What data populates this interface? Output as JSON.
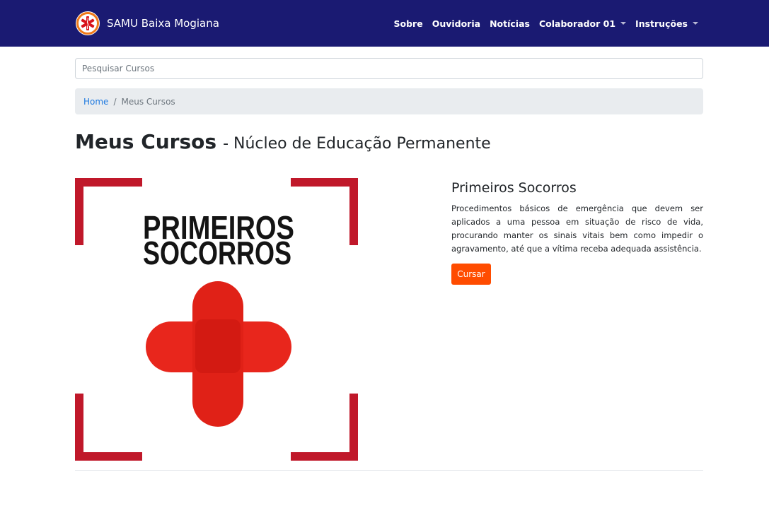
{
  "navbar": {
    "brand": "SAMU Baixa Mogiana",
    "logo_icon": "samu-star-of-life-logo",
    "links": [
      {
        "label": "Sobre",
        "dropdown": false
      },
      {
        "label": "Ouvidoria",
        "dropdown": false
      },
      {
        "label": "Notícias",
        "dropdown": false
      },
      {
        "label": "Colaborador 01",
        "dropdown": true
      },
      {
        "label": "Instruções",
        "dropdown": true
      }
    ],
    "background": "#1a1a72"
  },
  "search": {
    "placeholder": "Pesquisar Cursos",
    "value": ""
  },
  "breadcrumb": {
    "home": "Home",
    "current": "Meus Cursos"
  },
  "page": {
    "title": "Meus Cursos",
    "subtitle": "- Núcleo de Educação Permanente"
  },
  "course": {
    "image": {
      "line1": "PRIMEIROS",
      "line2": "SOCORROS",
      "frame_color": "#c0182a",
      "cross_color": "#e8261c",
      "icon": "bandage-cross-image"
    },
    "name": "Primeiros Socorros",
    "description": "Procedimentos básicos de emergência que devem ser aplicados a uma pessoa em situação de risco de vida, procurando manter os sinais vitais bem como impedir o agravamento, até que a vítima receba adequada assistência.",
    "button_label": "Cursar",
    "button_color": "#ff4c00"
  }
}
